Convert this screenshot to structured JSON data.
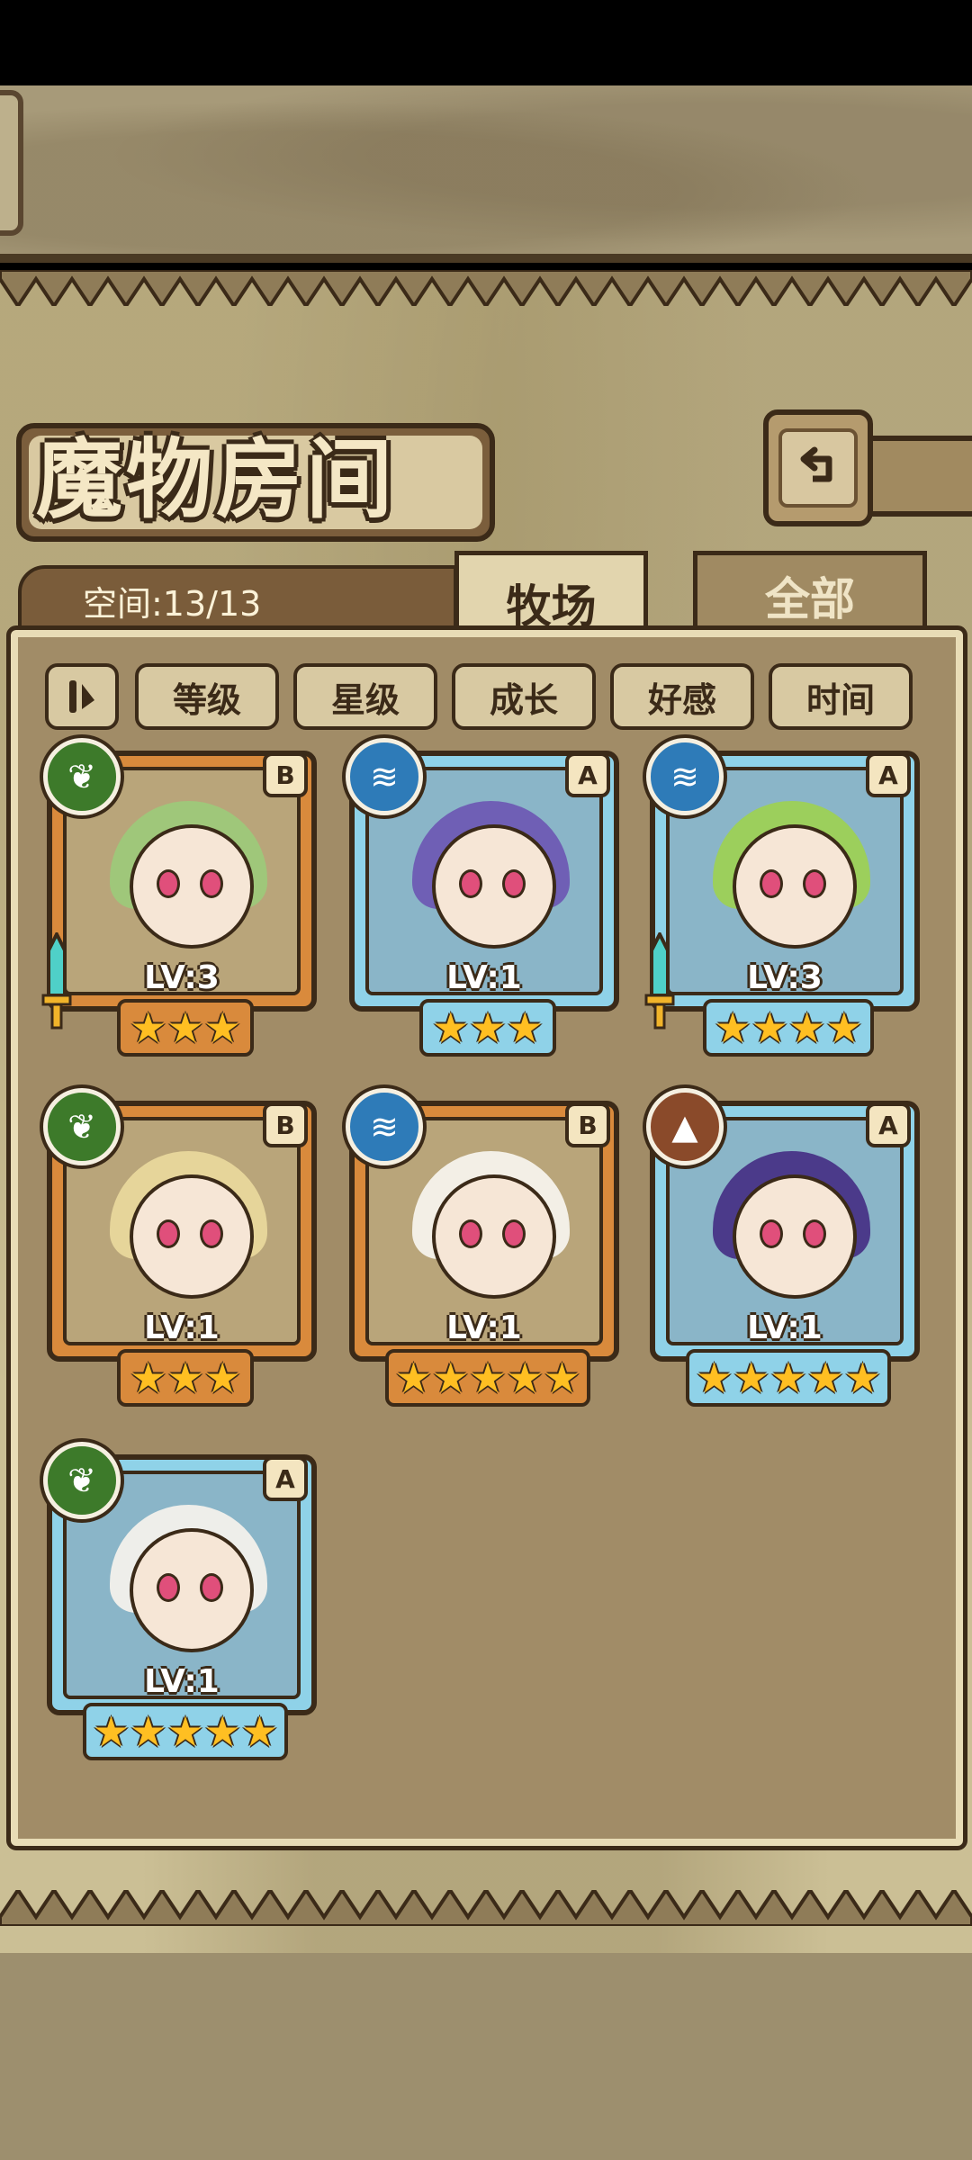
{
  "title": "魔物房间",
  "capacity": "空间:13/13",
  "tabs": [
    {
      "label": "牧场",
      "active": true
    },
    {
      "label": "全部",
      "active": false
    }
  ],
  "sort_buttons": [
    "等级",
    "星级",
    "成长",
    "好感",
    "时间"
  ],
  "colors": {
    "panel": "#cbbf95",
    "content": "#a18c67",
    "outline": "#3b2a18",
    "orange_frame": "#d98a3c",
    "blue_frame": "#8fd2e8",
    "star": "#ffbf22"
  },
  "monsters": [
    {
      "element": "grass-icon",
      "rank": "B",
      "level": "LV:3",
      "stars": 3,
      "frame": "orange",
      "hair": "#9fc77a",
      "equipped": true
    },
    {
      "element": "water-icon",
      "rank": "A",
      "level": "LV:1",
      "stars": 3,
      "frame": "blue",
      "hair": "#6f5fb5",
      "equipped": false
    },
    {
      "element": "water-icon",
      "rank": "A",
      "level": "LV:3",
      "stars": 4,
      "frame": "blue",
      "hair": "#9ccf5c",
      "equipped": true
    },
    {
      "element": "grass-icon",
      "rank": "B",
      "level": "LV:1",
      "stars": 3,
      "frame": "orange",
      "hair": "#e6d59a",
      "equipped": false
    },
    {
      "element": "water-icon",
      "rank": "B",
      "level": "LV:1",
      "stars": 5,
      "frame": "orange",
      "hair": "#f3efe6",
      "equipped": false
    },
    {
      "element": "earth-icon",
      "rank": "A",
      "level": "LV:1",
      "stars": 5,
      "frame": "blue",
      "hair": "#4b3a8a",
      "equipped": false
    },
    {
      "element": "grass-icon",
      "rank": "A",
      "level": "LV:1",
      "stars": 5,
      "frame": "blue",
      "hair": "#eeeeea",
      "equipped": false
    }
  ]
}
